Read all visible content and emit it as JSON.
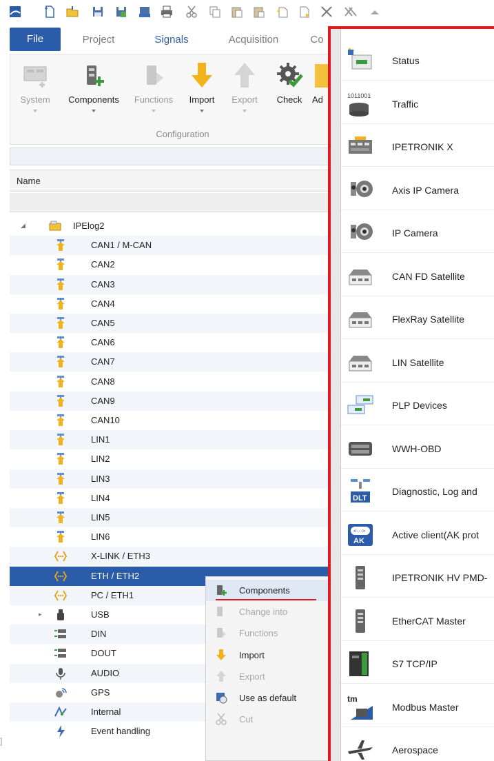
{
  "ribbon": {
    "tabs": [
      {
        "label": "File",
        "kind": "file"
      },
      {
        "label": "Project",
        "kind": "normal"
      },
      {
        "label": "Signals",
        "kind": "active"
      },
      {
        "label": "Acquisition",
        "kind": "normal"
      },
      {
        "label": "Co",
        "kind": "normal"
      }
    ],
    "buttons": [
      {
        "label": "System",
        "enabled": false,
        "icon": "system-icon"
      },
      {
        "label": "Components",
        "enabled": true,
        "icon": "components-icon"
      },
      {
        "label": "Functions",
        "enabled": false,
        "icon": "functions-icon"
      },
      {
        "label": "Import",
        "enabled": true,
        "icon": "import-arrow-icon"
      },
      {
        "label": "Export",
        "enabled": false,
        "icon": "export-arrow-icon"
      },
      {
        "label": "Check",
        "enabled": true,
        "icon": "check-gear-icon"
      },
      {
        "label": "Ad",
        "enabled": true,
        "icon": "add-icon"
      }
    ],
    "group_label": "Configuration"
  },
  "columns": {
    "name_header": "Name"
  },
  "tree": {
    "rows": [
      {
        "label": "IPElog2",
        "icon": "logger-icon",
        "level": 0,
        "expander": "◢",
        "selected": false
      },
      {
        "label": "CAN1 / M-CAN",
        "icon": "bus-port-icon",
        "level": 1,
        "expander": "",
        "selected": false
      },
      {
        "label": "CAN2",
        "icon": "bus-port-icon",
        "level": 1,
        "expander": "",
        "selected": false
      },
      {
        "label": "CAN3",
        "icon": "bus-port-icon",
        "level": 1,
        "expander": "",
        "selected": false
      },
      {
        "label": "CAN4",
        "icon": "bus-port-icon",
        "level": 1,
        "expander": "",
        "selected": false
      },
      {
        "label": "CAN5",
        "icon": "bus-port-icon",
        "level": 1,
        "expander": "",
        "selected": false
      },
      {
        "label": "CAN6",
        "icon": "bus-port-icon",
        "level": 1,
        "expander": "",
        "selected": false
      },
      {
        "label": "CAN7",
        "icon": "bus-port-icon",
        "level": 1,
        "expander": "",
        "selected": false
      },
      {
        "label": "CAN8",
        "icon": "bus-port-icon",
        "level": 1,
        "expander": "",
        "selected": false
      },
      {
        "label": "CAN9",
        "icon": "bus-port-icon",
        "level": 1,
        "expander": "",
        "selected": false
      },
      {
        "label": "CAN10",
        "icon": "bus-port-icon",
        "level": 1,
        "expander": "",
        "selected": false
      },
      {
        "label": "LIN1",
        "icon": "bus-port-icon",
        "level": 1,
        "expander": "",
        "selected": false
      },
      {
        "label": "LIN2",
        "icon": "bus-port-icon",
        "level": 1,
        "expander": "",
        "selected": false
      },
      {
        "label": "LIN3",
        "icon": "bus-port-icon",
        "level": 1,
        "expander": "",
        "selected": false
      },
      {
        "label": "LIN4",
        "icon": "bus-port-icon",
        "level": 1,
        "expander": "",
        "selected": false
      },
      {
        "label": "LIN5",
        "icon": "bus-port-icon",
        "level": 1,
        "expander": "",
        "selected": false
      },
      {
        "label": "LIN6",
        "icon": "bus-port-icon",
        "level": 1,
        "expander": "",
        "selected": false
      },
      {
        "label": "X-LINK / ETH3",
        "icon": "ethernet-icon",
        "level": 1,
        "expander": "",
        "selected": false
      },
      {
        "label": "ETH / ETH2",
        "icon": "ethernet-icon",
        "level": 1,
        "expander": "",
        "selected": true
      },
      {
        "label": "PC / ETH1",
        "icon": "ethernet-icon",
        "level": 1,
        "expander": "",
        "selected": false
      },
      {
        "label": "USB",
        "icon": "usb-icon",
        "level": 1,
        "expander": "▸",
        "selected": false
      },
      {
        "label": "DIN",
        "icon": "digital-io-icon",
        "level": 1,
        "expander": "",
        "selected": false
      },
      {
        "label": "DOUT",
        "icon": "digital-io-icon",
        "level": 1,
        "expander": "",
        "selected": false
      },
      {
        "label": "AUDIO",
        "icon": "microphone-icon",
        "level": 1,
        "expander": "",
        "selected": false
      },
      {
        "label": "GPS",
        "icon": "gps-icon",
        "level": 1,
        "expander": "",
        "selected": false
      },
      {
        "label": "Internal",
        "icon": "internal-icon",
        "level": 1,
        "expander": "",
        "selected": false
      },
      {
        "label": "Event handling",
        "icon": "event-icon",
        "level": 1,
        "expander": "",
        "selected": false
      }
    ]
  },
  "context_menu": {
    "items": [
      {
        "label": "Components",
        "enabled": true,
        "highlight": true,
        "icon": "components-icon"
      },
      {
        "label": "Change into",
        "enabled": false,
        "highlight": false,
        "icon": "change-icon"
      },
      {
        "label": "Functions",
        "enabled": false,
        "highlight": false,
        "icon": "functions-icon"
      },
      {
        "label": "Import",
        "enabled": true,
        "highlight": false,
        "icon": "import-arrow-icon"
      },
      {
        "label": "Export",
        "enabled": false,
        "highlight": false,
        "icon": "export-arrow-icon"
      },
      {
        "label": "Use as default",
        "enabled": true,
        "highlight": false,
        "icon": "default-icon"
      },
      {
        "label": "Cut",
        "enabled": false,
        "highlight": false,
        "icon": "scissors-icon"
      }
    ]
  },
  "components_panel": {
    "items": [
      {
        "label": "Status",
        "icon": "status-icon"
      },
      {
        "label": "Traffic",
        "icon": "traffic-icon"
      },
      {
        "label": "IPETRONIK X",
        "icon": "ipetronik-x-icon"
      },
      {
        "label": "Axis IP Camera",
        "icon": "axis-camera-icon"
      },
      {
        "label": "IP Camera",
        "icon": "ip-camera-icon"
      },
      {
        "label": "CAN FD Satellite",
        "icon": "satellite-icon"
      },
      {
        "label": "FlexRay Satellite",
        "icon": "satellite-icon"
      },
      {
        "label": "LIN Satellite",
        "icon": "satellite-icon"
      },
      {
        "label": "PLP Devices",
        "icon": "plp-icon"
      },
      {
        "label": "WWH-OBD",
        "icon": "obd-icon"
      },
      {
        "label": "Diagnostic, Log and",
        "icon": "dlt-icon"
      },
      {
        "label": "Active client(AK prot",
        "icon": "ak-icon"
      },
      {
        "label": "IPETRONIK HV PMD-",
        "icon": "hv-module-icon"
      },
      {
        "label": "EtherCAT Master",
        "icon": "ethercat-icon"
      },
      {
        "label": "S7 TCP/IP",
        "icon": "s7-icon"
      },
      {
        "label": "Modbus Master",
        "icon": "modbus-icon"
      },
      {
        "label": "Aerospace",
        "icon": "aerospace-icon"
      }
    ]
  },
  "colors": {
    "accent_blue": "#2b5ca9",
    "highlight_red": "#e0191f",
    "import_yellow": "#f1b21c"
  }
}
